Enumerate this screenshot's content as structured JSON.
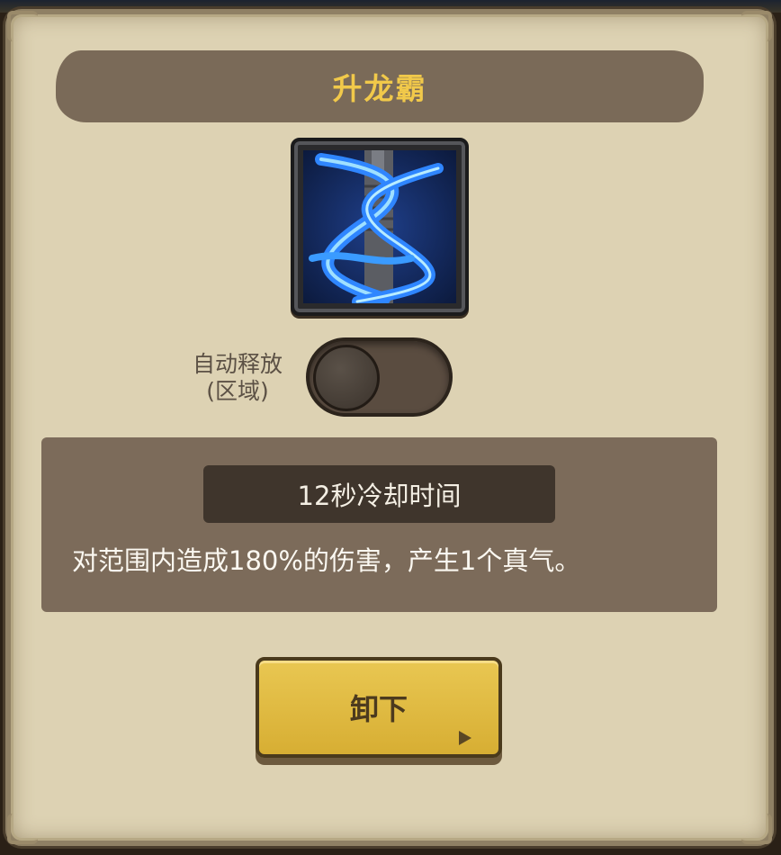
{
  "skill": {
    "title": "升龙霸",
    "icon": "lightning-sword-icon",
    "colors": {
      "title": "#f1c94a",
      "icon_glow": "#3aa0ff"
    }
  },
  "auto_release": {
    "label_line1": "自动释放",
    "label_line2": "(区域)",
    "state": "off"
  },
  "details": {
    "cooldown": "12秒冷却时间",
    "description": "对范围内造成180%的伤害，产生1个真气。"
  },
  "actions": {
    "unequip_label": "卸下"
  }
}
